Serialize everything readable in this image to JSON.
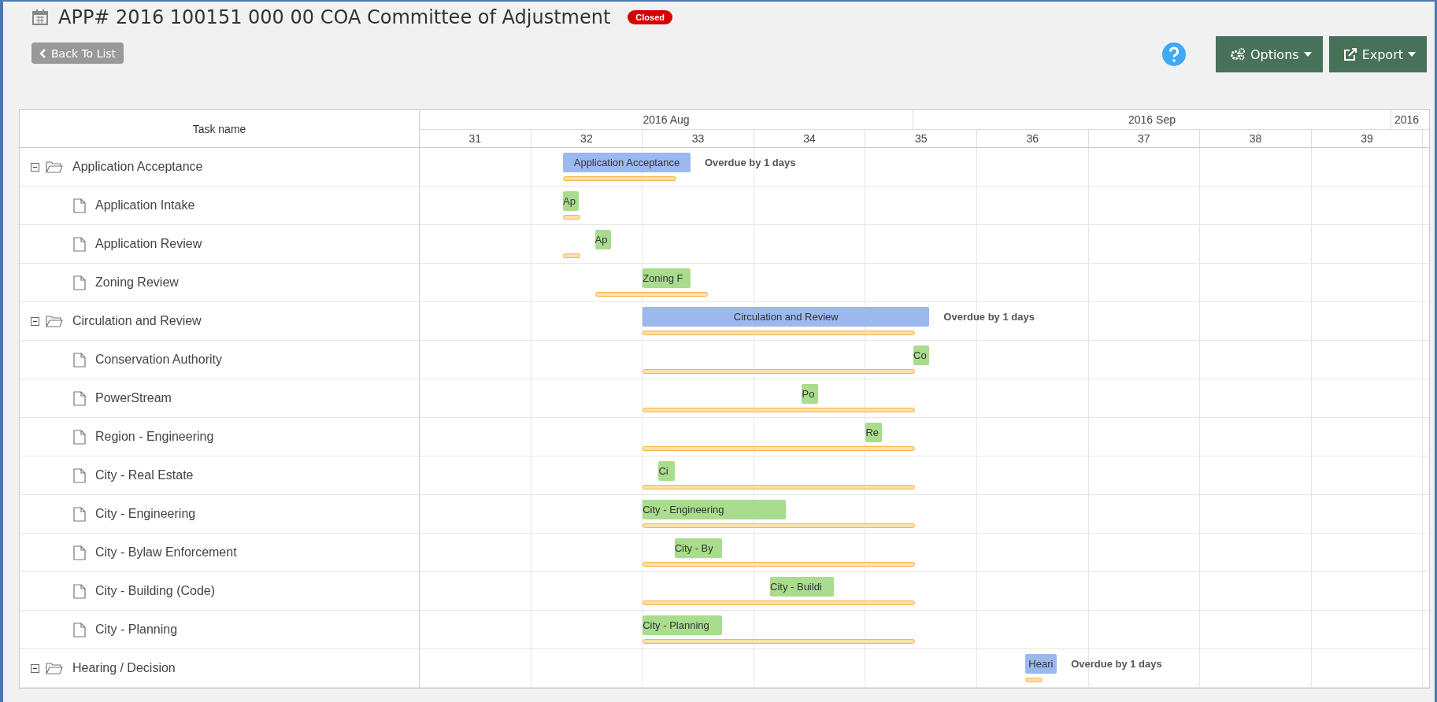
{
  "header": {
    "title": "APP# 2016 100151 000 00 COA Committee of Adjustment",
    "status": "Closed",
    "back_button": "Back To List",
    "buttons": [
      "Options",
      "Export"
    ]
  },
  "gantt": {
    "column_header": "Task name",
    "months": [
      "2016 Aug",
      "2016 Sep",
      "2016"
    ],
    "weeks": [
      "31",
      "32",
      "33",
      "34",
      "35",
      "36",
      "37",
      "38",
      "39"
    ],
    "tasks": [
      {
        "kind": "group",
        "name": "Application Acceptance",
        "expanded": true,
        "bar_text": "Application Acceptance",
        "note": "Overdue by 1 days",
        "children": [
          {
            "kind": "task",
            "name": "Application Intake",
            "bar_text": "Ap"
          },
          {
            "kind": "task",
            "name": "Application Review",
            "bar_text": "Ap"
          },
          {
            "kind": "task",
            "name": "Zoning Review",
            "bar_text": "Zoning F"
          }
        ]
      },
      {
        "kind": "group",
        "name": "Circulation and Review",
        "expanded": true,
        "bar_text": "Circulation and Review",
        "note": "Overdue by 1 days",
        "children": [
          {
            "kind": "task",
            "name": "Conservation Authority",
            "bar_text": "Co"
          },
          {
            "kind": "task",
            "name": "PowerStream",
            "bar_text": "Po"
          },
          {
            "kind": "task",
            "name": "Region - Engineering",
            "bar_text": "Re"
          },
          {
            "kind": "task",
            "name": "City - Real Estate",
            "bar_text": "Ci"
          },
          {
            "kind": "task",
            "name": "City - Engineering",
            "bar_text": "City - Engineering"
          },
          {
            "kind": "task",
            "name": "City - Bylaw Enforcement",
            "bar_text": "City - By"
          },
          {
            "kind": "task",
            "name": "City - Building (Code)",
            "bar_text": "City - Buildi"
          },
          {
            "kind": "task",
            "name": "City - Planning",
            "bar_text": "City - Planning"
          }
        ]
      },
      {
        "kind": "group",
        "name": "Hearing / Decision",
        "expanded": true,
        "bar_text": "Heari",
        "note": "Overdue by 1 days"
      }
    ]
  }
}
